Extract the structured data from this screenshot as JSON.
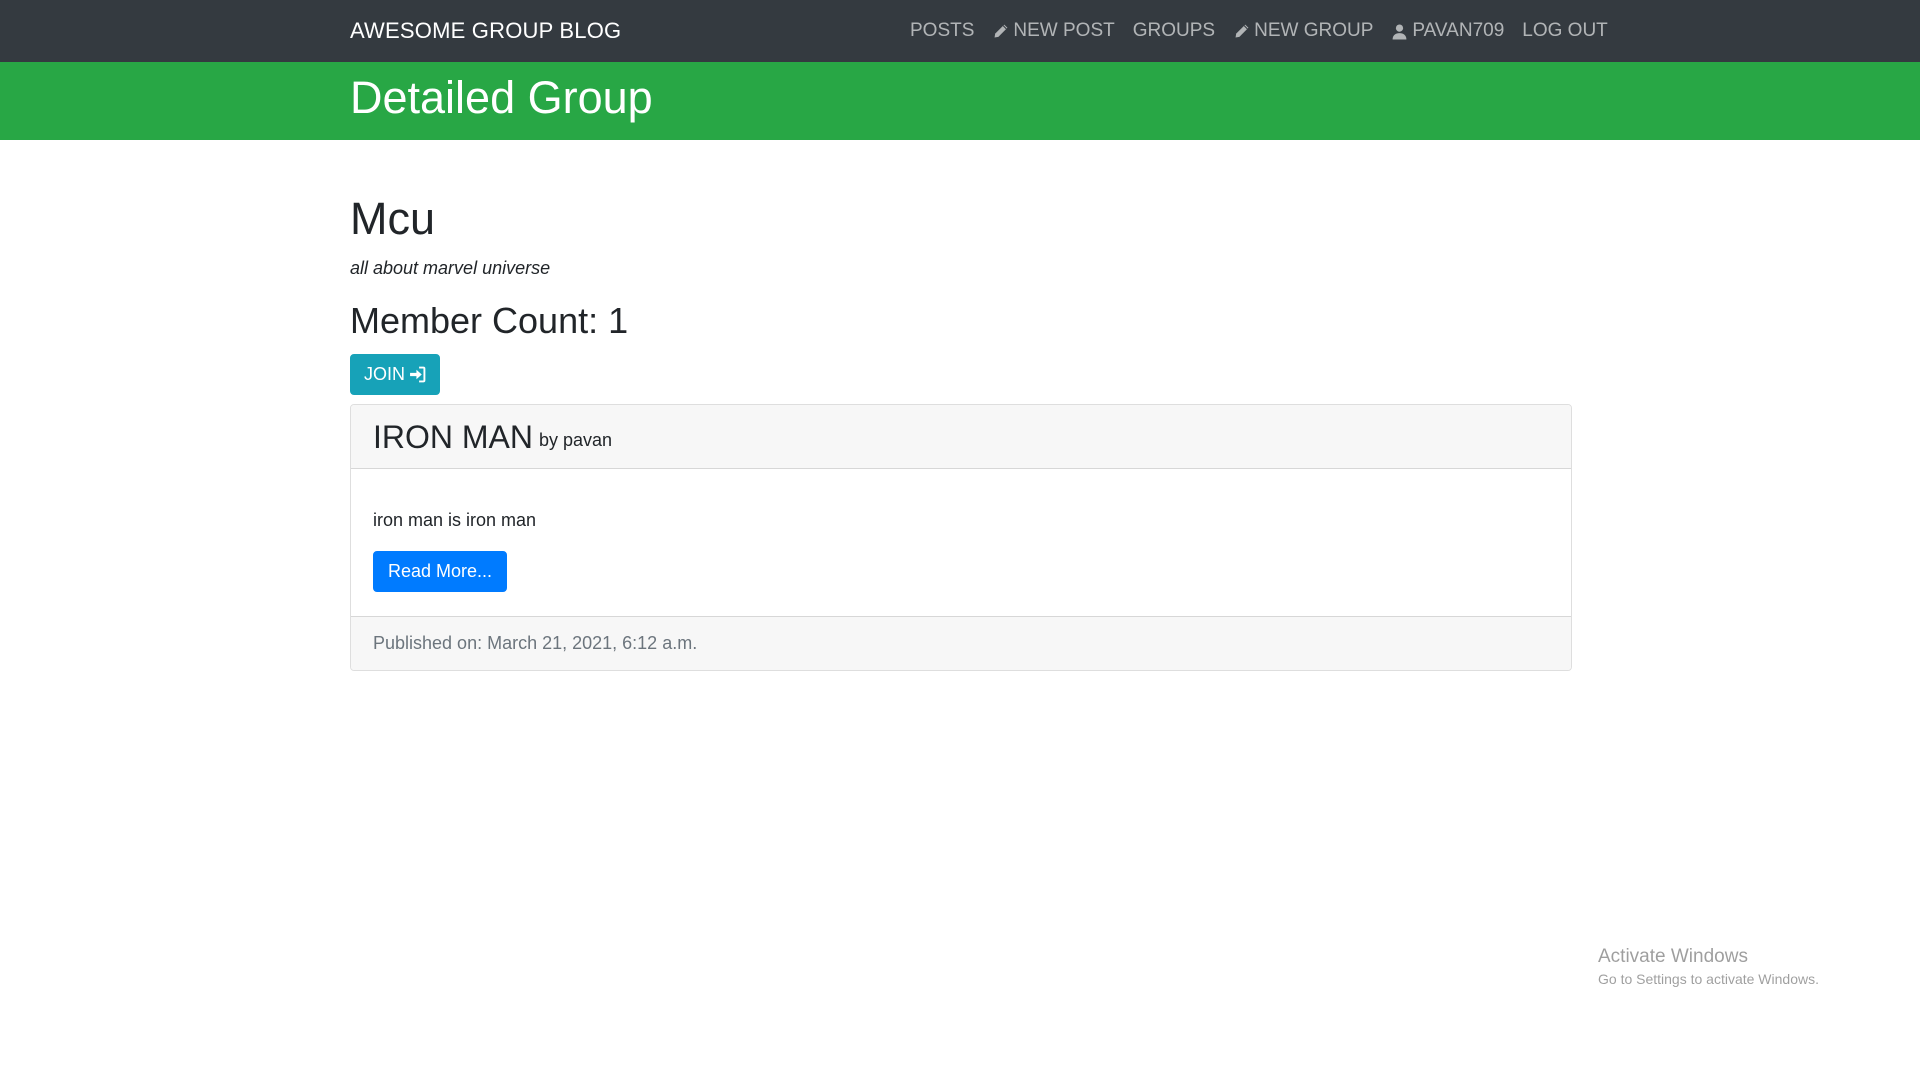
{
  "navbar": {
    "brand": "AWESOME GROUP BLOG",
    "links": [
      {
        "label": "POSTS",
        "icon": ""
      },
      {
        "label": "NEW POST",
        "icon": "pencil-icon"
      },
      {
        "label": "GROUPS",
        "icon": ""
      },
      {
        "label": "NEW GROUP",
        "icon": "pencil-icon"
      },
      {
        "label": "PAVAN709",
        "icon": "user-icon"
      },
      {
        "label": "LOG OUT",
        "icon": ""
      }
    ]
  },
  "hero": {
    "title": "Detailed Group"
  },
  "group": {
    "name": "Mcu",
    "description": "all about marvel universe",
    "member_count": "Member Count: 1",
    "join_label": "JOIN",
    "join_icon": "sign-in-icon"
  },
  "posts": [
    {
      "title": "IRON MAN",
      "by": "by pavan",
      "text": "iron man is iron man",
      "read_more": "Read More...",
      "published": "Published on: March 21, 2021, 6:12 a.m."
    }
  ],
  "watermark": {
    "title": "Activate Windows",
    "subtitle": "Go to Settings to activate Windows."
  },
  "colors": {
    "navbar_bg": "#343a40",
    "hero_bg": "#28a745",
    "join_btn": "#17a2b8",
    "read_more_btn": "#007bff"
  }
}
